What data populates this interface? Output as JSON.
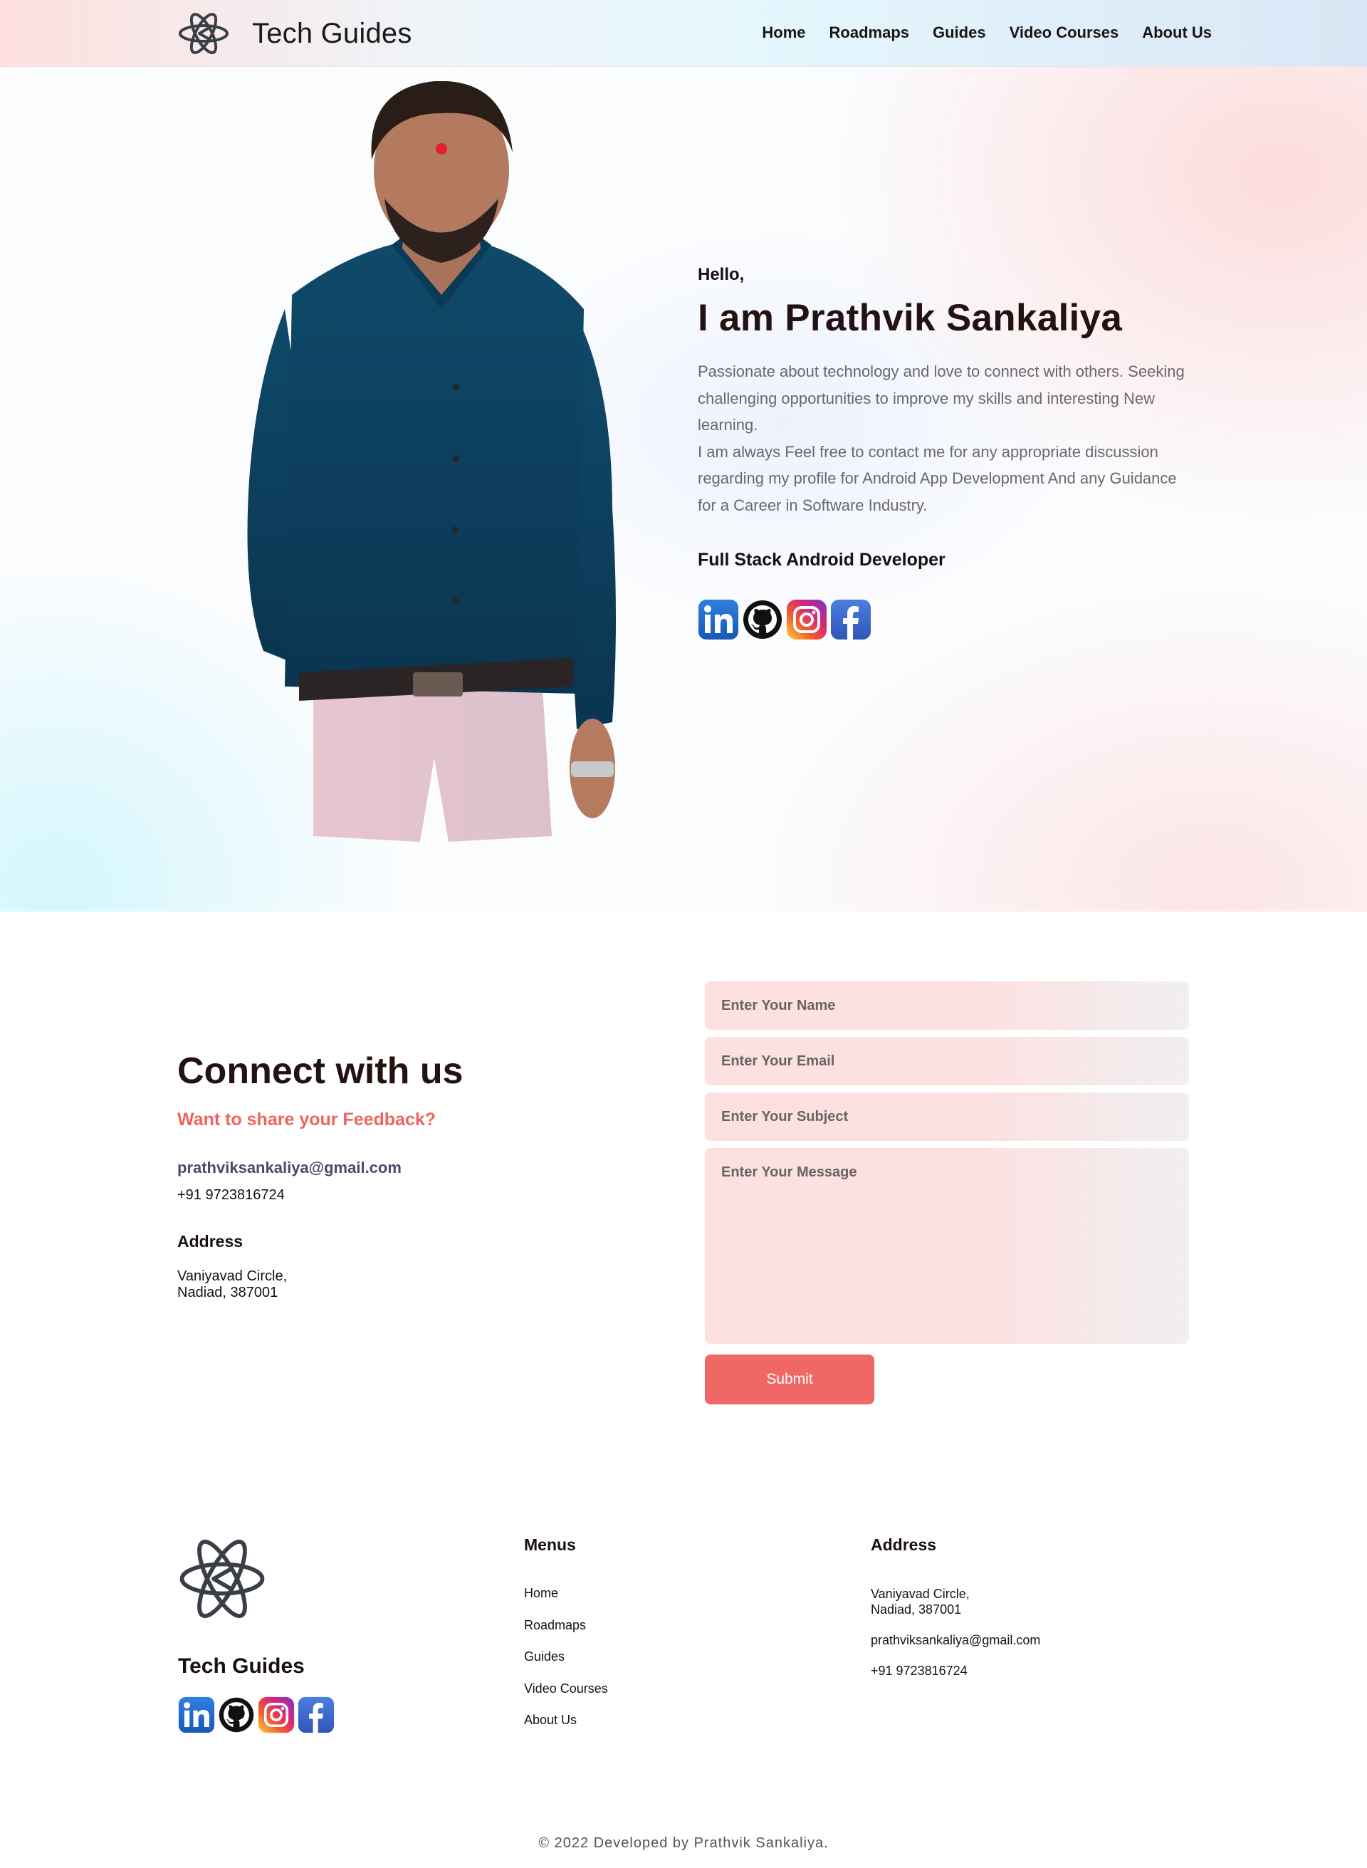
{
  "nav": {
    "brand": "Tech Guides",
    "items": [
      {
        "label": "Home"
      },
      {
        "label": "Roadmaps"
      },
      {
        "label": "Guides"
      },
      {
        "label": "Video Courses"
      },
      {
        "label": "About Us"
      }
    ]
  },
  "hero": {
    "greeting": "Hello,",
    "title": "I am Prathvik Sankaliya",
    "desc_1": "Passionate about technology and love to connect with others. Seeking challenging opportunities to improve my skills and interesting New learning.",
    "desc_2": "I am always Feel free to contact me for any appropriate discussion regarding my profile for Android App Development And any Guidance for a Career in Software Industry.",
    "role": "Full Stack Android Developer",
    "social_icons": [
      "linkedin-icon",
      "github-icon",
      "instagram-icon",
      "facebook-icon"
    ]
  },
  "contact": {
    "title": "Connect with us",
    "subtitle": "Want to share your Feedback?",
    "email": "prathviksankaliya@gmail.com",
    "phone": "+91 9723816724",
    "address_heading": "Address",
    "address_line1": "Vaniyavad Circle,",
    "address_line2": "Nadiad, 387001",
    "form": {
      "name_placeholder": "Enter Your Name",
      "email_placeholder": "Enter Your Email",
      "subject_placeholder": "Enter Your Subject",
      "message_placeholder": "Enter Your Message",
      "submit_label": "Submit"
    }
  },
  "footer": {
    "brand": "Tech Guides",
    "menus_heading": "Menus",
    "menus": [
      {
        "label": "Home"
      },
      {
        "label": "Roadmaps"
      },
      {
        "label": "Guides"
      },
      {
        "label": "Video Courses"
      },
      {
        "label": "About Us"
      }
    ],
    "address_heading": "Address",
    "address_line1": "Vaniyavad Circle,",
    "address_line2": "Nadiad, 387001",
    "email": "prathviksankaliya@gmail.com",
    "phone": "+91 9723816724",
    "copyright": "© 2022 Developed by Prathvik Sankaliya."
  },
  "colors": {
    "accent": "#f06866",
    "heading": "#241111",
    "muted": "#6b6670",
    "link_blue": "#4a4a6a"
  }
}
